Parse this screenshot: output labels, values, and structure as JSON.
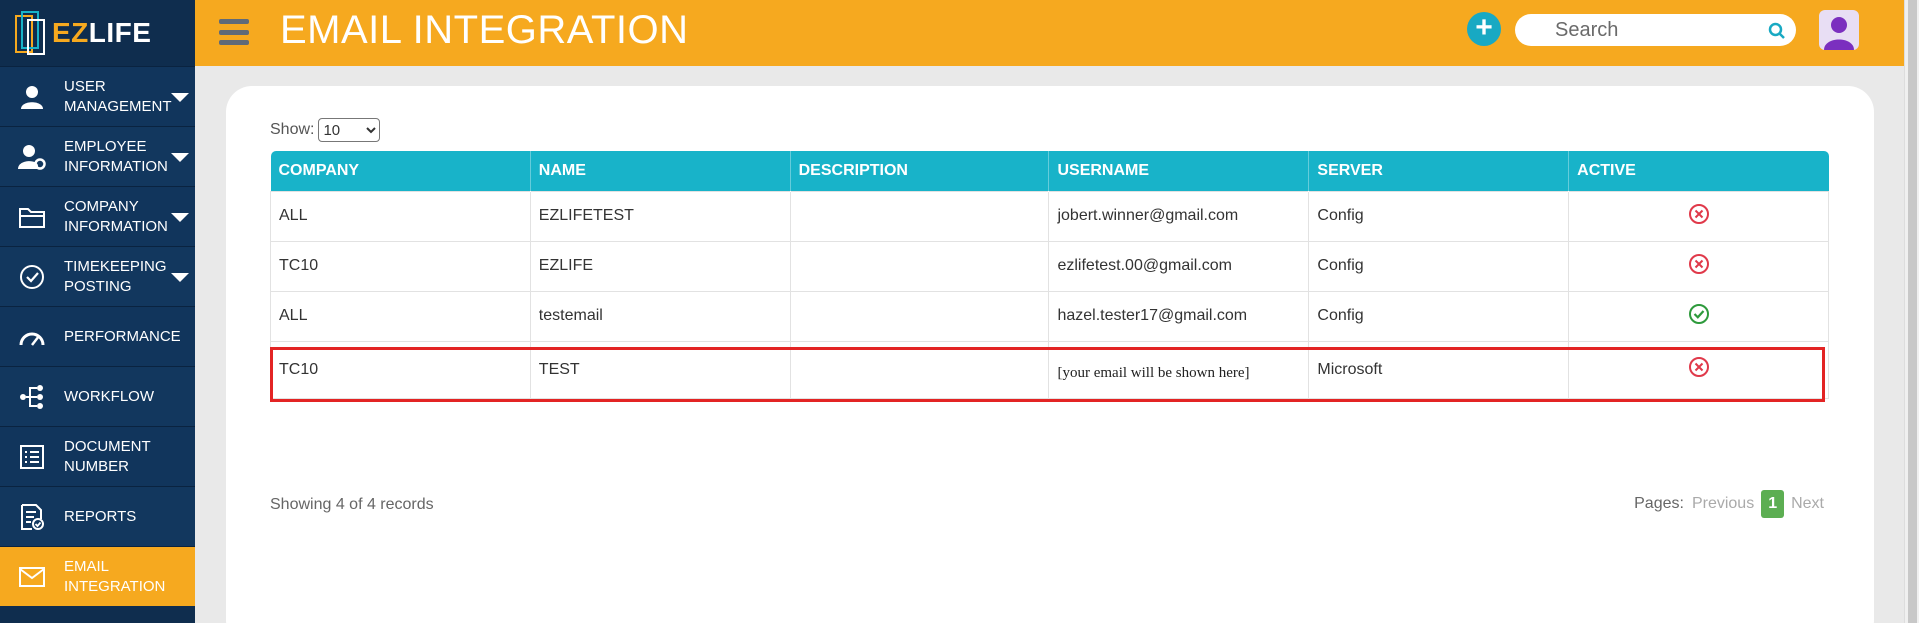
{
  "brand": {
    "ez": "EZ",
    "life": "LIFE"
  },
  "header": {
    "title": "EMAIL INTEGRATION",
    "add_label": "+",
    "search_placeholder": "Search"
  },
  "sidebar": {
    "items": [
      {
        "label": "USER MANAGEMENT",
        "icon": "user-icon",
        "has_caret": true
      },
      {
        "label": "EMPLOYEE INFORMATION",
        "icon": "user-gear-icon",
        "has_caret": true
      },
      {
        "label": "COMPANY INFORMATION",
        "icon": "folder-icon",
        "has_caret": true
      },
      {
        "label": "TIMEKEEPING POSTING",
        "icon": "check-circle-icon",
        "has_caret": true
      },
      {
        "label": "PERFORMANCE",
        "icon": "gauge-icon",
        "has_caret": false
      },
      {
        "label": "WORKFLOW",
        "icon": "workflow-icon",
        "has_caret": false
      },
      {
        "label": "DOCUMENT NUMBER",
        "icon": "list-icon",
        "has_caret": false
      },
      {
        "label": "REPORTS",
        "icon": "report-icon",
        "has_caret": false
      },
      {
        "label": "EMAIL INTEGRATION",
        "icon": "envelope-icon",
        "has_caret": false,
        "active": true
      }
    ]
  },
  "controls": {
    "show_label": "Show:",
    "page_size": "10",
    "page_size_options": [
      "10"
    ]
  },
  "table": {
    "columns": [
      "COMPANY",
      "NAME",
      "DESCRIPTION",
      "USERNAME",
      "SERVER",
      "ACTIVE"
    ],
    "rows": [
      {
        "company": "ALL",
        "name": "EZLIFETEST",
        "description": "",
        "username": "jobert.winner@gmail.com",
        "server": "Config",
        "active": false
      },
      {
        "company": "TC10",
        "name": "EZLIFE",
        "description": "",
        "username": "ezlifetest.00@gmail.com",
        "server": "Config",
        "active": false
      },
      {
        "company": "ALL",
        "name": "testemail",
        "description": "",
        "username": "hazel.tester17@gmail.com",
        "server": "Config",
        "active": true
      },
      {
        "company": "TC10",
        "name": "TEST",
        "description": "",
        "username": "[your email will be shown here]",
        "server": "Microsoft",
        "active": false
      }
    ]
  },
  "footer": {
    "records_text": "Showing 4 of 4 records",
    "pages_label": "Pages:",
    "previous": "Previous",
    "current_page": "1",
    "next": "Next"
  },
  "colors": {
    "header": "#f6a91f",
    "sidebar": "#0f2d4e",
    "table_header": "#18b3c9",
    "inactive": "#e0394a",
    "active": "#2e9a3c",
    "highlight_outline": "#e32424",
    "page_badge": "#5cae52"
  }
}
